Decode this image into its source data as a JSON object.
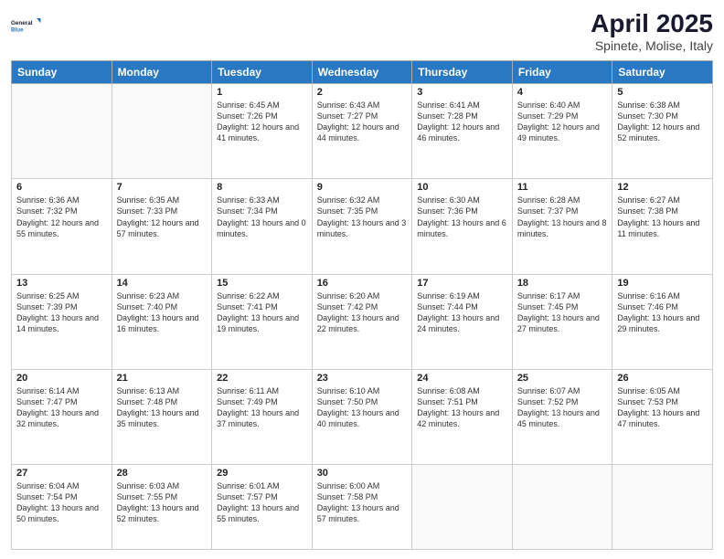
{
  "header": {
    "logo_line1": "General",
    "logo_line2": "Blue",
    "month": "April 2025",
    "location": "Spinete, Molise, Italy"
  },
  "days_of_week": [
    "Sunday",
    "Monday",
    "Tuesday",
    "Wednesday",
    "Thursday",
    "Friday",
    "Saturday"
  ],
  "weeks": [
    [
      {
        "day": "",
        "info": ""
      },
      {
        "day": "",
        "info": ""
      },
      {
        "day": "1",
        "info": "Sunrise: 6:45 AM\nSunset: 7:26 PM\nDaylight: 12 hours and 41 minutes."
      },
      {
        "day": "2",
        "info": "Sunrise: 6:43 AM\nSunset: 7:27 PM\nDaylight: 12 hours and 44 minutes."
      },
      {
        "day": "3",
        "info": "Sunrise: 6:41 AM\nSunset: 7:28 PM\nDaylight: 12 hours and 46 minutes."
      },
      {
        "day": "4",
        "info": "Sunrise: 6:40 AM\nSunset: 7:29 PM\nDaylight: 12 hours and 49 minutes."
      },
      {
        "day": "5",
        "info": "Sunrise: 6:38 AM\nSunset: 7:30 PM\nDaylight: 12 hours and 52 minutes."
      }
    ],
    [
      {
        "day": "6",
        "info": "Sunrise: 6:36 AM\nSunset: 7:32 PM\nDaylight: 12 hours and 55 minutes."
      },
      {
        "day": "7",
        "info": "Sunrise: 6:35 AM\nSunset: 7:33 PM\nDaylight: 12 hours and 57 minutes."
      },
      {
        "day": "8",
        "info": "Sunrise: 6:33 AM\nSunset: 7:34 PM\nDaylight: 13 hours and 0 minutes."
      },
      {
        "day": "9",
        "info": "Sunrise: 6:32 AM\nSunset: 7:35 PM\nDaylight: 13 hours and 3 minutes."
      },
      {
        "day": "10",
        "info": "Sunrise: 6:30 AM\nSunset: 7:36 PM\nDaylight: 13 hours and 6 minutes."
      },
      {
        "day": "11",
        "info": "Sunrise: 6:28 AM\nSunset: 7:37 PM\nDaylight: 13 hours and 8 minutes."
      },
      {
        "day": "12",
        "info": "Sunrise: 6:27 AM\nSunset: 7:38 PM\nDaylight: 13 hours and 11 minutes."
      }
    ],
    [
      {
        "day": "13",
        "info": "Sunrise: 6:25 AM\nSunset: 7:39 PM\nDaylight: 13 hours and 14 minutes."
      },
      {
        "day": "14",
        "info": "Sunrise: 6:23 AM\nSunset: 7:40 PM\nDaylight: 13 hours and 16 minutes."
      },
      {
        "day": "15",
        "info": "Sunrise: 6:22 AM\nSunset: 7:41 PM\nDaylight: 13 hours and 19 minutes."
      },
      {
        "day": "16",
        "info": "Sunrise: 6:20 AM\nSunset: 7:42 PM\nDaylight: 13 hours and 22 minutes."
      },
      {
        "day": "17",
        "info": "Sunrise: 6:19 AM\nSunset: 7:44 PM\nDaylight: 13 hours and 24 minutes."
      },
      {
        "day": "18",
        "info": "Sunrise: 6:17 AM\nSunset: 7:45 PM\nDaylight: 13 hours and 27 minutes."
      },
      {
        "day": "19",
        "info": "Sunrise: 6:16 AM\nSunset: 7:46 PM\nDaylight: 13 hours and 29 minutes."
      }
    ],
    [
      {
        "day": "20",
        "info": "Sunrise: 6:14 AM\nSunset: 7:47 PM\nDaylight: 13 hours and 32 minutes."
      },
      {
        "day": "21",
        "info": "Sunrise: 6:13 AM\nSunset: 7:48 PM\nDaylight: 13 hours and 35 minutes."
      },
      {
        "day": "22",
        "info": "Sunrise: 6:11 AM\nSunset: 7:49 PM\nDaylight: 13 hours and 37 minutes."
      },
      {
        "day": "23",
        "info": "Sunrise: 6:10 AM\nSunset: 7:50 PM\nDaylight: 13 hours and 40 minutes."
      },
      {
        "day": "24",
        "info": "Sunrise: 6:08 AM\nSunset: 7:51 PM\nDaylight: 13 hours and 42 minutes."
      },
      {
        "day": "25",
        "info": "Sunrise: 6:07 AM\nSunset: 7:52 PM\nDaylight: 13 hours and 45 minutes."
      },
      {
        "day": "26",
        "info": "Sunrise: 6:05 AM\nSunset: 7:53 PM\nDaylight: 13 hours and 47 minutes."
      }
    ],
    [
      {
        "day": "27",
        "info": "Sunrise: 6:04 AM\nSunset: 7:54 PM\nDaylight: 13 hours and 50 minutes."
      },
      {
        "day": "28",
        "info": "Sunrise: 6:03 AM\nSunset: 7:55 PM\nDaylight: 13 hours and 52 minutes."
      },
      {
        "day": "29",
        "info": "Sunrise: 6:01 AM\nSunset: 7:57 PM\nDaylight: 13 hours and 55 minutes."
      },
      {
        "day": "30",
        "info": "Sunrise: 6:00 AM\nSunset: 7:58 PM\nDaylight: 13 hours and 57 minutes."
      },
      {
        "day": "",
        "info": ""
      },
      {
        "day": "",
        "info": ""
      },
      {
        "day": "",
        "info": ""
      }
    ]
  ]
}
